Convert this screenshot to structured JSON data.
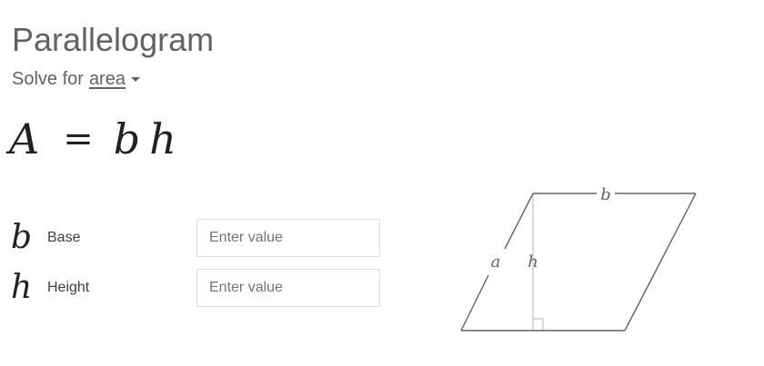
{
  "title": "Parallelogram",
  "solve": {
    "prefix": "Solve for",
    "target": "area",
    "icon": "caret-down-icon"
  },
  "formula": {
    "lhs": "A",
    "equals": "=",
    "term1": "b",
    "term2": "h"
  },
  "variables": [
    {
      "symbol": "b",
      "label": "Base",
      "value": "",
      "placeholder": "Enter value"
    },
    {
      "symbol": "h",
      "label": "Height",
      "value": "",
      "placeholder": "Enter value"
    }
  ],
  "diagram": {
    "label_b": "b",
    "label_a": "a",
    "label_h": "h",
    "stroke_color": "#5f6368",
    "height_line_color": "#c0c0c0"
  }
}
